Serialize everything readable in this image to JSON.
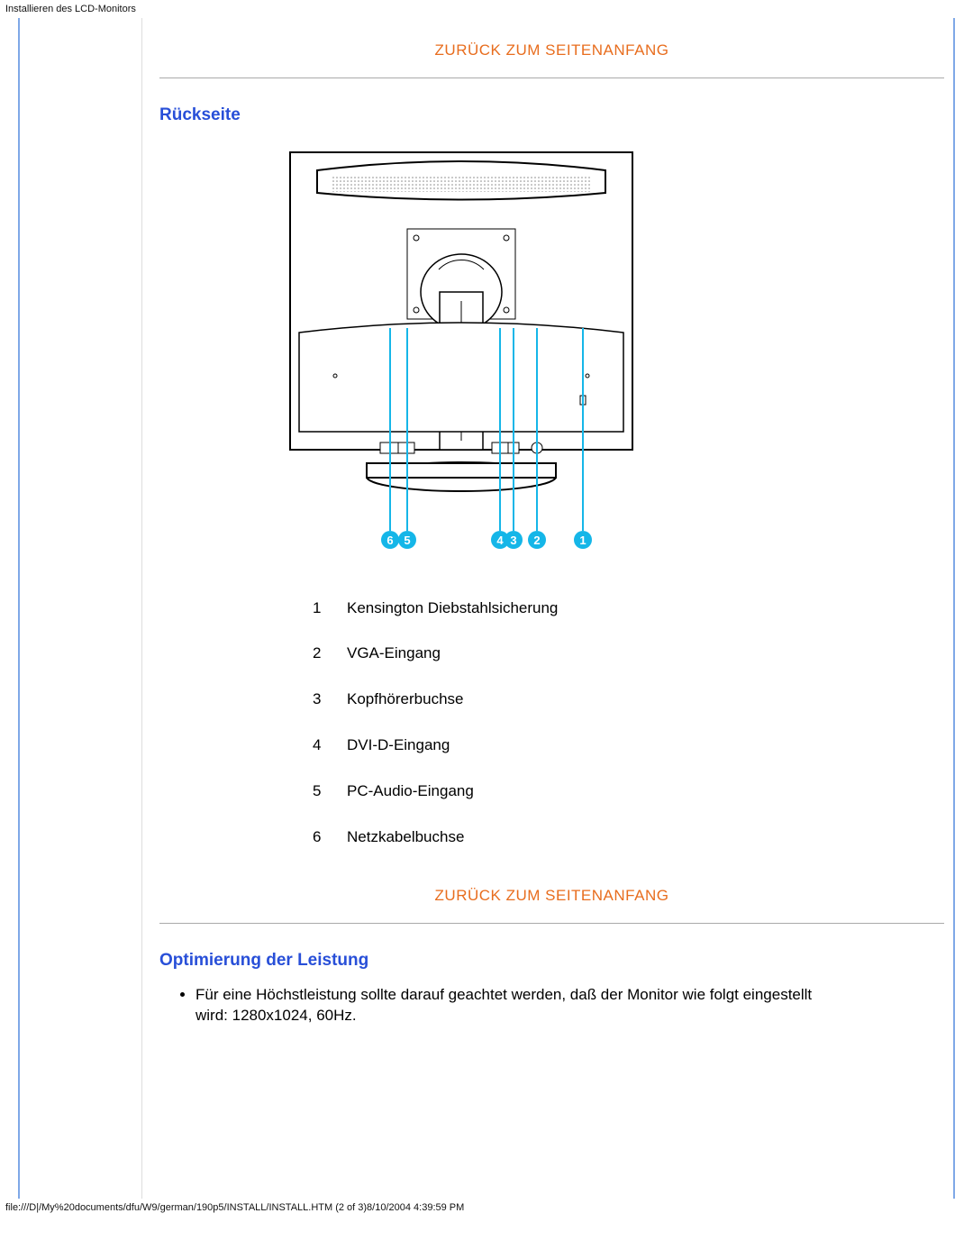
{
  "header_title": "Installieren des LCD-Monitors",
  "links": {
    "back_top_1": "ZURÜCK ZUM SEITENANFANG",
    "back_top_2": "ZURÜCK ZUM SEITENANFANG"
  },
  "sections": {
    "rear_heading": "Rückseite",
    "optimize_heading": "Optimierung der Leistung"
  },
  "callouts": [
    {
      "num": "1",
      "text": "Kensington Diebstahlsicherung"
    },
    {
      "num": "2",
      "text": "VGA-Eingang"
    },
    {
      "num": "3",
      "text": "Kopfhörerbuchse"
    },
    {
      "num": "4",
      "text": "DVI-D-Eingang"
    },
    {
      "num": "5",
      "text": "PC-Audio-Eingang"
    },
    {
      "num": "6",
      "text": "Netzkabelbuchse"
    }
  ],
  "callout_labels_diagram": [
    "6",
    "5",
    "4",
    "3",
    "2",
    "1"
  ],
  "optimize_bullet": "Für eine Höchstleistung sollte darauf geachtet werden, daß der Monitor wie folgt eingestellt wird: 1280x1024, 60Hz.",
  "footer_text": "file:///D|/My%20documents/dfu/W9/german/190p5/INSTALL/INSTALL.HTM (2 of 3)8/10/2004 4:39:59 PM"
}
